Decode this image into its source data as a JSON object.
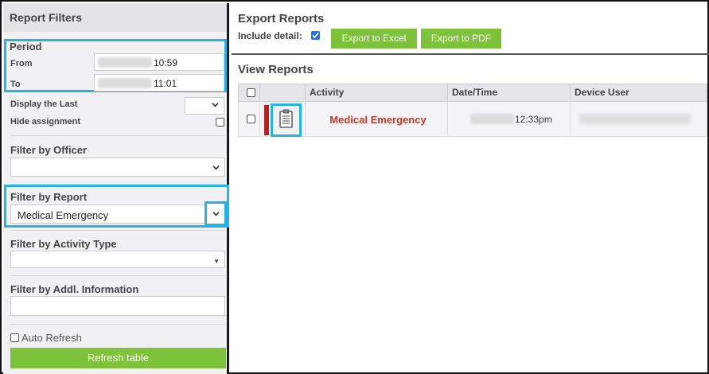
{
  "sidebar": {
    "title": "Report Filters",
    "period": {
      "title": "Period",
      "from_label": "From",
      "from_time": "10:59",
      "to_label": "To",
      "to_time": "11:01"
    },
    "display_last_label": "Display the Last",
    "hide_assignment_label": "Hide assignment",
    "filter_officer_label": "Filter by Officer",
    "filter_officer_value": "",
    "filter_report_label": "Filter by Report",
    "filter_report_value": "Medical Emergency",
    "filter_activity_label": "Filter by Activity Type",
    "filter_activity_value": "",
    "filter_addl_label": "Filter by Addl. Information",
    "filter_addl_value": "",
    "auto_refresh_label": "Auto Refresh",
    "refresh_button": "Refresh table"
  },
  "export": {
    "title": "Export Reports",
    "include_detail_label": "Include detail:",
    "include_detail_checked": true,
    "excel_button": "Export to Excel",
    "pdf_button": "Export to PDF"
  },
  "view": {
    "title": "View Reports",
    "columns": [
      "Activity",
      "Date/Time",
      "Device User"
    ],
    "rows": [
      {
        "activity": "Medical Emergency",
        "time": "12:33pm",
        "icon": "clipboard-icon",
        "status_color": "#b22222"
      }
    ]
  },
  "colors": {
    "accent_green": "#7dc23a",
    "highlight_blue": "#27b3e0",
    "activity_red": "#c0392b"
  }
}
